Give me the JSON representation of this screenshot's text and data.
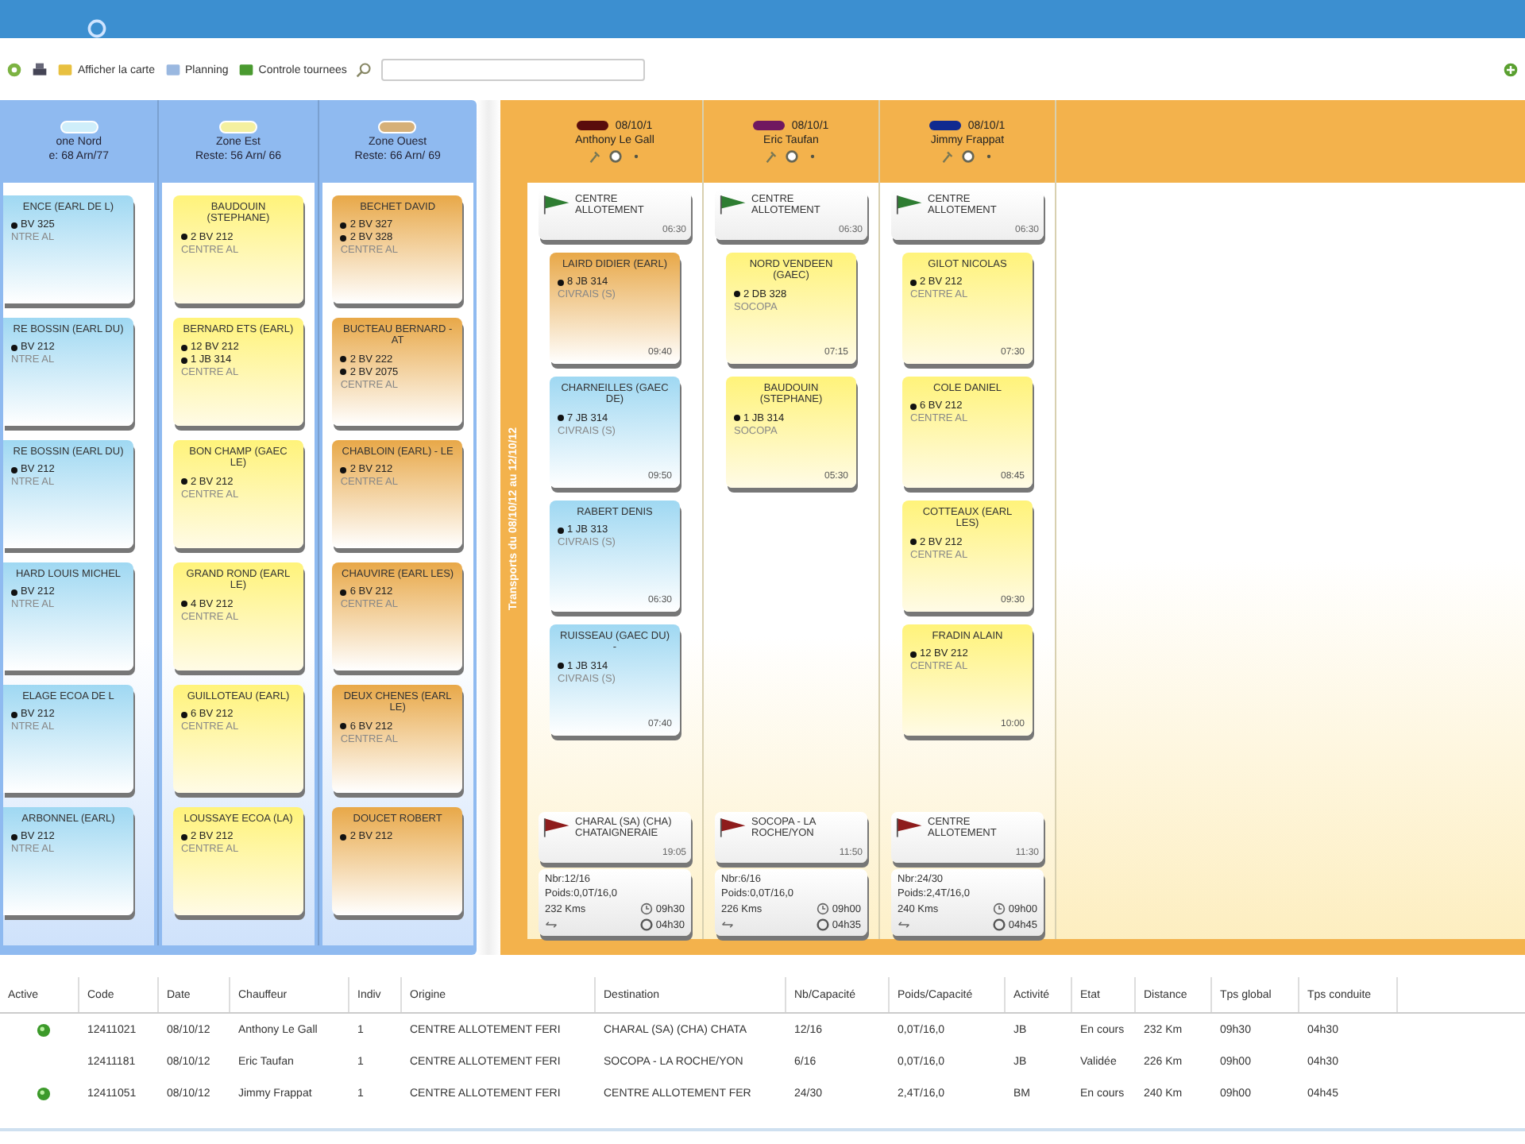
{
  "toolbar": {
    "items": [
      {
        "kind": "button",
        "label": "Afficher la carte"
      },
      {
        "kind": "button",
        "label": "Planning"
      },
      {
        "kind": "button",
        "label": "Controle tournees"
      }
    ]
  },
  "zones": [
    {
      "name": "one Nord",
      "reste": "e: 68 Arn/77",
      "color": "#cfeefa",
      "cards": [
        {
          "kind": "blue",
          "name": "ENCE (EARL DE L)",
          "lines": [
            "BV 325"
          ],
          "origin": "NTRE AL"
        },
        {
          "kind": "blue",
          "name": "RE BOSSIN (EARL DU)",
          "lines": [
            "BV 212"
          ],
          "origin": "NTRE AL"
        },
        {
          "kind": "blue",
          "name": "RE BOSSIN (EARL DU)",
          "lines": [
            "BV 212"
          ],
          "origin": "NTRE AL"
        },
        {
          "kind": "blue",
          "name": "HARD LOUIS MICHEL",
          "lines": [
            "BV 212"
          ],
          "origin": "NTRE AL"
        },
        {
          "kind": "blue",
          "name": "ELAGE ECOA DE L",
          "lines": [
            "BV 212"
          ],
          "origin": "NTRE AL"
        },
        {
          "kind": "blue",
          "name": "ARBONNEL (EARL)",
          "lines": [
            "BV 212"
          ],
          "origin": "NTRE AL"
        }
      ]
    },
    {
      "name": "Zone Est",
      "reste": "Reste: 56 Arn/ 66",
      "color": "#f4f0a0",
      "cards": [
        {
          "kind": "yellow",
          "name": "BAUDOUIN (STEPHANE)",
          "lines": [
            "2 BV 212"
          ],
          "origin": "CENTRE AL"
        },
        {
          "kind": "yellow",
          "name": "BERNARD ETS (EARL)",
          "lines": [
            "12 BV 212",
            "1 JB 314"
          ],
          "origin": "CENTRE AL"
        },
        {
          "kind": "yellow",
          "name": "BON CHAMP (GAEC LE)",
          "lines": [
            "2 BV 212"
          ],
          "origin": "CENTRE AL"
        },
        {
          "kind": "yellow",
          "name": "GRAND ROND (EARL LE)",
          "lines": [
            "4 BV 212"
          ],
          "origin": "CENTRE AL"
        },
        {
          "kind": "yellow",
          "name": "GUILLOTEAU (EARL)",
          "lines": [
            "6 BV 212"
          ],
          "origin": "CENTRE AL"
        },
        {
          "kind": "yellow",
          "name": "LOUSSAYE ECOA (LA)",
          "lines": [
            "2 BV 212"
          ],
          "origin": "CENTRE AL"
        }
      ]
    },
    {
      "name": "Zone Ouest",
      "reste": "Reste: 66 Arn/ 69",
      "color": "#d6b078",
      "cards": [
        {
          "kind": "orange",
          "name": "BECHET DAVID",
          "lines": [
            "2 BV 327",
            "2 BV 328"
          ],
          "origin": "CENTRE AL"
        },
        {
          "kind": "orange",
          "name": "BUCTEAU BERNARD - AT",
          "lines": [
            "2 BV 222",
            "2 BV 2075"
          ],
          "origin": "CENTRE AL"
        },
        {
          "kind": "orange",
          "name": "CHABLOIN (EARL) - LE",
          "lines": [
            "2 BV 212"
          ],
          "origin": "CENTRE AL"
        },
        {
          "kind": "orange",
          "name": "CHAUVIRE (EARL LES)",
          "lines": [
            "6 BV 212"
          ],
          "origin": "CENTRE AL"
        },
        {
          "kind": "orange",
          "name": "DEUX CHENES (EARL LE)",
          "lines": [
            "6 BV 212"
          ],
          "origin": "CENTRE AL"
        },
        {
          "kind": "orange",
          "name": "DOUCET ROBERT",
          "lines": [
            "2 BV 212"
          ]
        }
      ]
    }
  ],
  "period": "Transports du 08/10/12 au 12/10/12",
  "drivers": [
    {
      "code": "08/10/1",
      "name": "Anthony Le Gall",
      "color": "#5a0c0c",
      "start": {
        "name": "CENTRE ALLOTEMENT",
        "time": "06:30"
      },
      "cards": [
        {
          "kind": "orange",
          "name": "LAIRD DIDIER (EARL)",
          "lines": [
            "8 JB 314"
          ],
          "origin": "CIVRAIS (S)",
          "time": "09:40"
        },
        {
          "kind": "blue",
          "name": "CHARNEILLES (GAEC DE)",
          "lines": [
            "7 JB 314"
          ],
          "origin": "CIVRAIS (S)",
          "time": "09:50"
        },
        {
          "kind": "blue",
          "name": "RABERT DENIS",
          "lines": [
            "1 JB 313"
          ],
          "origin": "CIVRAIS (S)",
          "time": "06:30"
        },
        {
          "kind": "blue",
          "name": "RUISSEAU (GAEC DU) -",
          "lines": [
            "1 JB 314"
          ],
          "origin": "CIVRAIS (S)",
          "time": "07:40"
        }
      ],
      "end": {
        "name": "CHARAL (SA) (CHA) CHATAIGNERAIE",
        "time": "19:05"
      },
      "summary": {
        "count": "Nbr:12/16",
        "weight": "Poids:0,0T/16,0",
        "distance": "232 Kms",
        "total": "09h30",
        "driving": "04h30"
      }
    },
    {
      "code": "08/10/1",
      "name": "Eric Taufan",
      "color": "#701860",
      "start": {
        "name": "CENTRE ALLOTEMENT",
        "time": "06:30"
      },
      "cards": [
        {
          "kind": "yellow",
          "name": "NORD VENDEEN (GAEC)",
          "lines": [
            "2 DB 328"
          ],
          "origin": "SOCOPA",
          "time": "07:15"
        },
        {
          "kind": "yellow",
          "name": "BAUDOUIN (STEPHANE)",
          "lines": [
            "1 JB 314"
          ],
          "origin": "SOCOPA",
          "time": "05:30"
        }
      ],
      "end": {
        "name": "SOCOPA - LA ROCHE/YON",
        "time": "11:50"
      },
      "summary": {
        "count": "Nbr:6/16",
        "weight": "Poids:0,0T/16,0",
        "distance": "226 Kms",
        "total": "09h00",
        "driving": "04h35"
      }
    },
    {
      "code": "08/10/1",
      "name": "Jimmy Frappat",
      "color": "#102a90",
      "start": {
        "name": "CENTRE ALLOTEMENT",
        "time": "06:30"
      },
      "cards": [
        {
          "kind": "yellow",
          "name": "GILOT NICOLAS",
          "lines": [
            "2 BV 212"
          ],
          "origin": "CENTRE AL",
          "time": "07:30"
        },
        {
          "kind": "yellow",
          "name": "COLE DANIEL",
          "lines": [
            "6 BV 212"
          ],
          "origin": "CENTRE AL",
          "time": "08:45"
        },
        {
          "kind": "yellow",
          "name": "COTTEAUX (EARL LES)",
          "lines": [
            "2 BV 212"
          ],
          "origin": "CENTRE AL",
          "time": "09:30"
        },
        {
          "kind": "yellow",
          "name": "FRADIN ALAIN",
          "lines": [
            "12 BV 212"
          ],
          "origin": "CENTRE AL",
          "time": "10:00"
        }
      ],
      "end": {
        "name": "CENTRE ALLOTEMENT",
        "time": "11:30"
      },
      "summary": {
        "count": "Nbr:24/30",
        "weight": "Poids:2,4T/16,0",
        "distance": "240 Kms",
        "total": "09h00",
        "driving": "04h45"
      }
    }
  ],
  "table": {
    "columns": [
      "Active",
      "Code",
      "Date",
      "Chauffeur",
      "Indiv",
      "Origine",
      "Destination",
      "Nb/Capacité",
      "Poids/Capacité",
      "Activité",
      "Etat",
      "Distance",
      "Tps global",
      "Tps conduite"
    ],
    "rows": [
      {
        "active": true,
        "cells": [
          "",
          "12411021",
          "08/10/12",
          "Anthony Le Gall",
          "1",
          "CENTRE ALLOTEMENT FERI",
          "CHARAL (SA) (CHA) CHATA",
          "12/16",
          "0,0T/16,0",
          "JB",
          "En cours",
          "232 Km",
          "09h30",
          "04h30"
        ]
      },
      {
        "active": false,
        "cells": [
          "",
          "12411181",
          "08/10/12",
          "Eric Taufan",
          "1",
          "CENTRE ALLOTEMENT FERI",
          "SOCOPA - LA ROCHE/YON",
          "6/16",
          "0,0T/16,0",
          "JB",
          "Validée",
          "226 Km",
          "09h00",
          "04h30"
        ]
      },
      {
        "active": true,
        "cells": [
          "",
          "12411051",
          "08/10/12",
          "Jimmy Frappat",
          "1",
          "CENTRE ALLOTEMENT FERI",
          "CENTRE ALLOTEMENT FER",
          "24/30",
          "2,4T/16,0",
          "BM",
          "En cours",
          "240 Km",
          "09h00",
          "04h45"
        ]
      }
    ]
  }
}
